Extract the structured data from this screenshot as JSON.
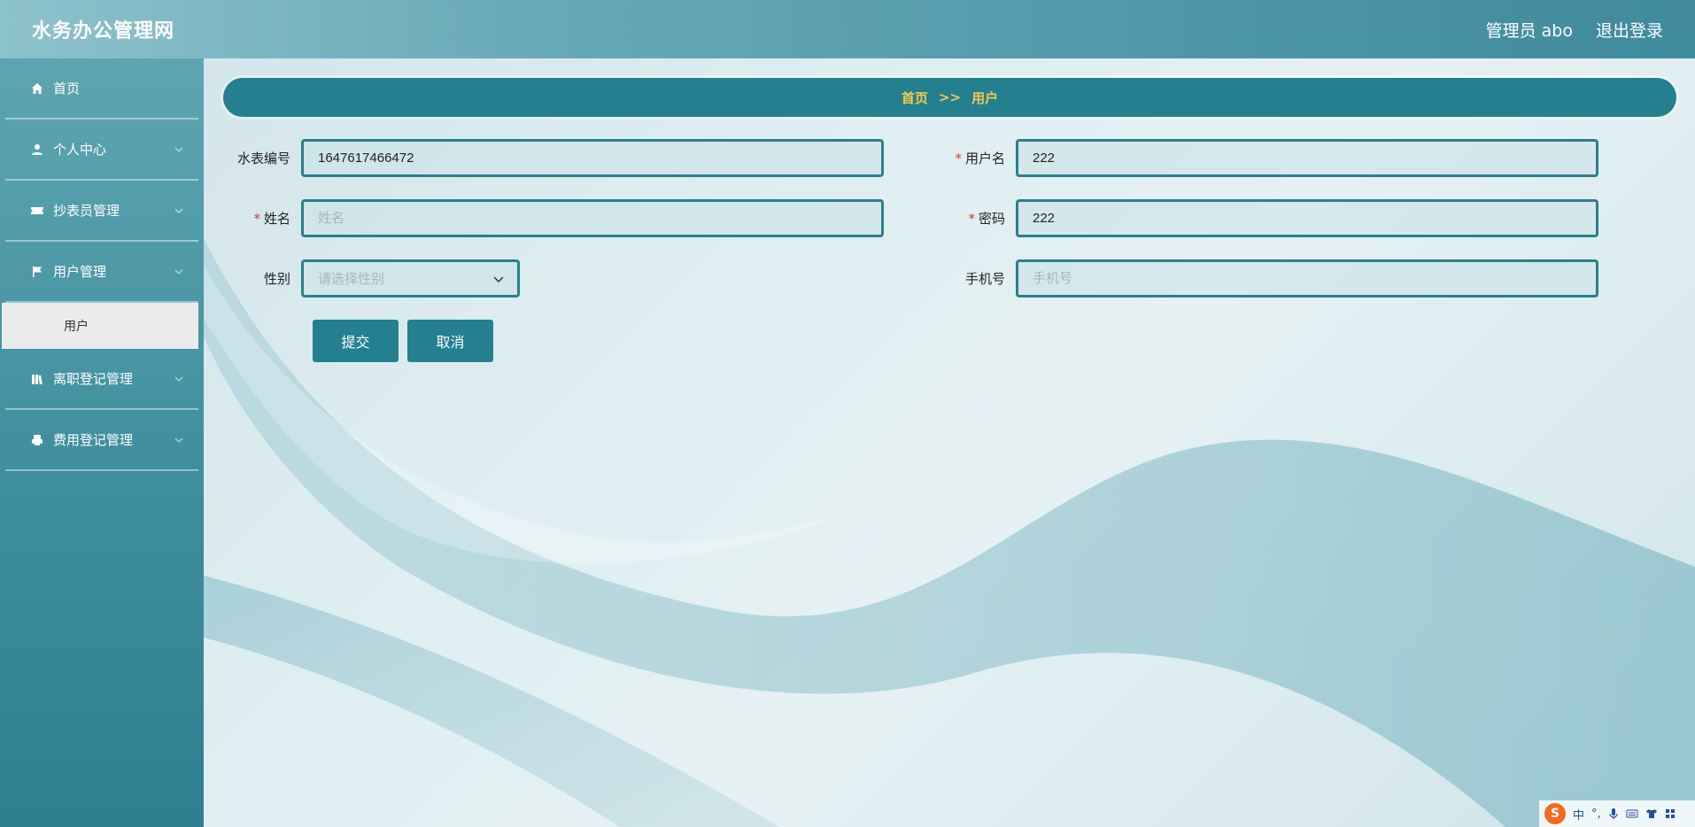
{
  "header": {
    "app_title": "水务办公管理网",
    "user_label": "管理员 abo",
    "logout_label": "退出登录"
  },
  "sidebar": {
    "items": [
      {
        "label": "首页",
        "icon": "home-icon"
      },
      {
        "label": "个人中心",
        "icon": "user-icon"
      },
      {
        "label": "抄表员管理",
        "icon": "ticket-icon"
      },
      {
        "label": "用户管理",
        "icon": "flag-icon"
      },
      {
        "label": "离职登记管理",
        "icon": "book-icon"
      },
      {
        "label": "费用登记管理",
        "icon": "printer-icon"
      }
    ],
    "active_submenu": "用户"
  },
  "breadcrumb": {
    "home": "首页",
    "separator": ">>",
    "current": "用户"
  },
  "form": {
    "meter_no": {
      "label": "水表编号",
      "value": "1647617466472"
    },
    "username": {
      "label": "用户名",
      "value": "222",
      "required": true
    },
    "name": {
      "label": "姓名",
      "placeholder": "姓名",
      "value": "",
      "required": true
    },
    "password": {
      "label": "密码",
      "value": "222",
      "required": true
    },
    "gender": {
      "label": "性别",
      "placeholder": "请选择性别"
    },
    "phone": {
      "label": "手机号",
      "placeholder": "手机号",
      "value": ""
    },
    "submit_label": "提交",
    "cancel_label": "取消"
  },
  "ime": {
    "logo": "S",
    "mode": "中"
  },
  "colors": {
    "accent": "#24808f",
    "breadcrumb_text": "#f2c94c",
    "required": "#e02f2f"
  }
}
